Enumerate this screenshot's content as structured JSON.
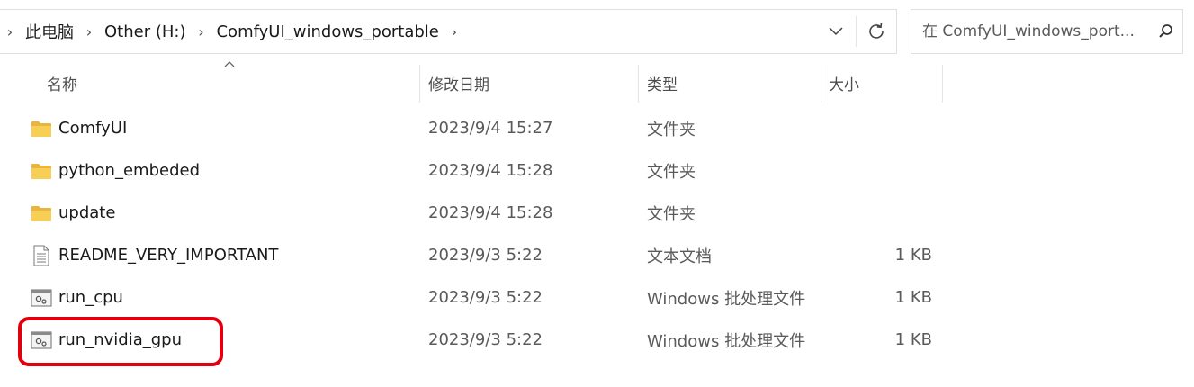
{
  "address_bar": {
    "breadcrumbs": [
      "此电脑",
      "Other (H:)",
      "ComfyUI_windows_portable"
    ],
    "separator": "›"
  },
  "search": {
    "placeholder": "在 ComfyUI_windows_port... ",
    "value": ""
  },
  "columns": {
    "name": "名称",
    "date": "修改日期",
    "type": "类型",
    "size": "大小"
  },
  "files": [
    {
      "name": "ComfyUI",
      "date": "2023/9/4 15:27",
      "type": "文件夹",
      "size": "",
      "icon": "folder-icon"
    },
    {
      "name": "python_embeded",
      "date": "2023/9/4 15:28",
      "type": "文件夹",
      "size": "",
      "icon": "folder-icon"
    },
    {
      "name": "update",
      "date": "2023/9/4 15:28",
      "type": "文件夹",
      "size": "",
      "icon": "folder-icon"
    },
    {
      "name": "README_VERY_IMPORTANT",
      "date": "2023/9/3 5:22",
      "type": "文本文档",
      "size": "1 KB",
      "icon": "text-file-icon"
    },
    {
      "name": "run_cpu",
      "date": "2023/9/3 5:22",
      "type": "Windows 批处理文件",
      "size": "1 KB",
      "icon": "batch-file-icon"
    },
    {
      "name": "run_nvidia_gpu",
      "date": "2023/9/3 5:22",
      "type": "Windows 批处理文件",
      "size": "1 KB",
      "icon": "batch-file-icon"
    }
  ],
  "colors": {
    "highlight": "#e0000e",
    "folder": "#f8c94a"
  }
}
